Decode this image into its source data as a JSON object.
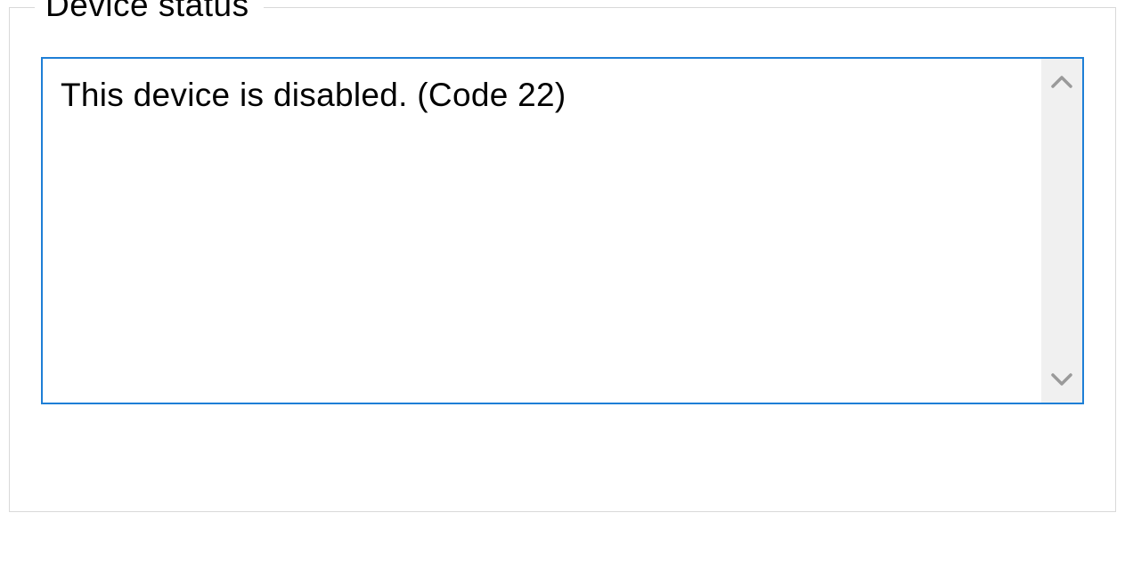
{
  "device_status": {
    "legend": "Device status",
    "message": "This device is disabled. (Code 22)"
  }
}
